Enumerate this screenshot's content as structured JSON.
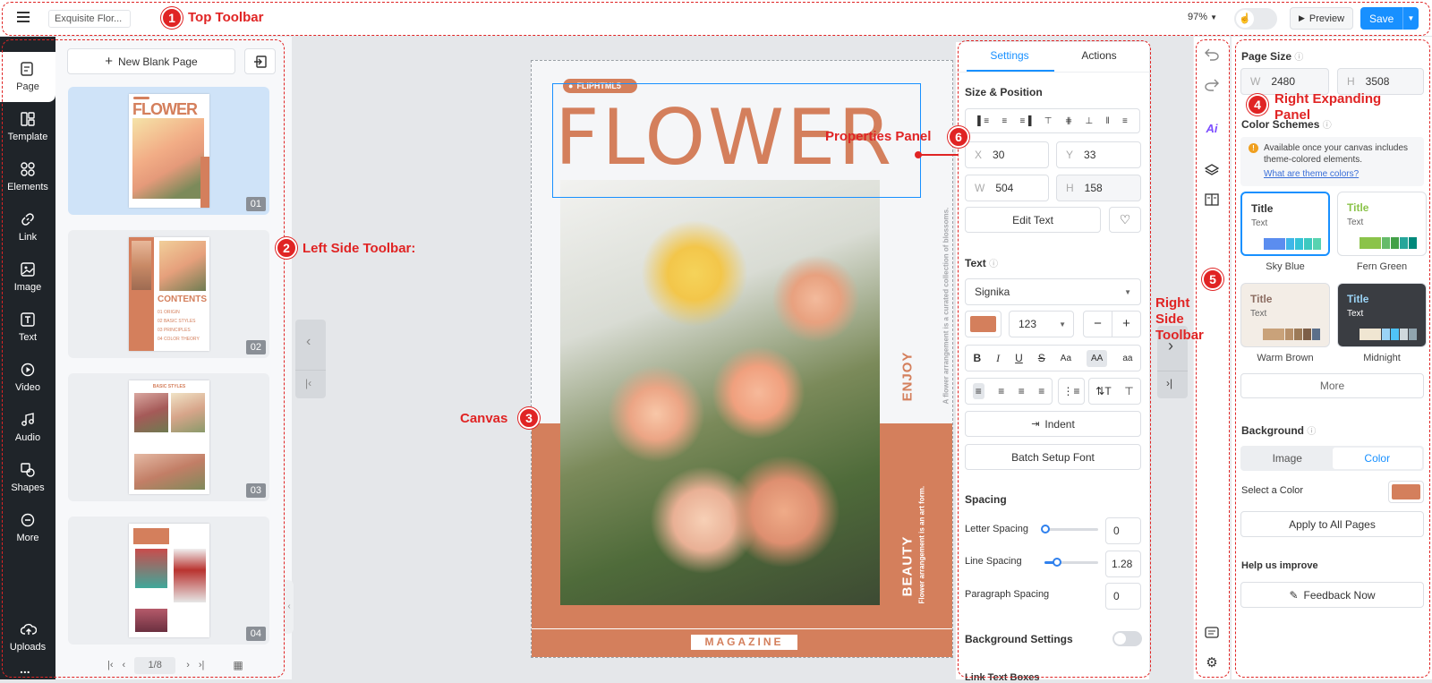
{
  "colors": {
    "accent": "#1890ff",
    "annotation": "#e02424",
    "brand": "#d47f5c",
    "sidebar": "#1f2429"
  },
  "topbar": {
    "menu_icon": "hamburger-icon",
    "doc_title": "Exquisite Flor...",
    "zoom": "97%",
    "preview_label": "Preview",
    "save_label": "Save"
  },
  "annotations": {
    "a1": {
      "num": "1",
      "label": "Top Toolbar"
    },
    "a2": {
      "num": "2",
      "label": "Left Side Toolbar:"
    },
    "a3": {
      "num": "3",
      "label": "Canvas"
    },
    "a4": {
      "num": "4",
      "label": "Right Expanding Panel"
    },
    "a5": {
      "num": "5",
      "label": "Right Side Toolbar"
    },
    "a6": {
      "num": "6",
      "label": "Properties Panel"
    }
  },
  "sidebar": {
    "items": [
      {
        "label": "Page",
        "icon": "page-icon"
      },
      {
        "label": "Template",
        "icon": "template-icon"
      },
      {
        "label": "Elements",
        "icon": "elements-icon"
      },
      {
        "label": "Link",
        "icon": "link-icon"
      },
      {
        "label": "Image",
        "icon": "image-icon"
      },
      {
        "label": "Text",
        "icon": "text-icon"
      },
      {
        "label": "Video",
        "icon": "video-icon"
      },
      {
        "label": "Audio",
        "icon": "audio-icon"
      },
      {
        "label": "Shapes",
        "icon": "shapes-icon"
      },
      {
        "label": "More",
        "icon": "more-icon"
      },
      {
        "label": "Uploads",
        "icon": "uploads-icon"
      }
    ],
    "overflow": "..."
  },
  "pages_panel": {
    "new_page_label": "New Blank Page",
    "thumbs": [
      {
        "num": "01",
        "title": "FLOWER"
      },
      {
        "num": "02",
        "title": "CONTENTS",
        "items": [
          "01  ORIGIN",
          "02  BASIC STYLES",
          "03  PRINCIPLES",
          "04  COLOR THEORY"
        ]
      },
      {
        "num": "03",
        "title": "BASIC STYLES"
      },
      {
        "num": "04"
      }
    ],
    "pager": {
      "current": "1/8"
    }
  },
  "canvas": {
    "logo": "FLIPHTML5",
    "headline": "FLOWER",
    "side_text_1": "A flower arrangement is a curated collection of blossoms.",
    "enjoy": "ENJOY",
    "beauty": "BEAUTY",
    "side_text_2": "Flower arrangement is an art form.",
    "footer": "MAGAZINE"
  },
  "props": {
    "tabs": {
      "settings": "Settings",
      "actions": "Actions"
    },
    "size_position": "Size & Position",
    "x_label": "X",
    "x": "30",
    "y_label": "Y",
    "y": "33",
    "w_label": "W",
    "w": "504",
    "h_label": "H",
    "h": "158",
    "edit_text": "Edit Text",
    "text_section": "Text",
    "font": "Signika",
    "font_size": "123",
    "indent": "Indent",
    "batch_font": "Batch Setup Font",
    "spacing": "Spacing",
    "letter_spacing_label": "Letter Spacing",
    "letter_spacing": "0",
    "line_spacing_label": "Line Spacing",
    "line_spacing": "1.28",
    "paragraph_spacing_label": "Paragraph Spacing",
    "paragraph_spacing": "0",
    "background_settings": "Background Settings",
    "link_text_boxes": "Link Text Boxes",
    "case_buttons": [
      "Aa",
      "AA",
      "aa"
    ]
  },
  "right_panel": {
    "page_size": "Page Size",
    "w_label": "W",
    "w": "2480",
    "h_label": "H",
    "h": "3508",
    "color_schemes": "Color Schemes",
    "notice": "Available once your canvas includes theme-colored elements.",
    "notice_link": "What are theme colors?",
    "schemes": [
      {
        "name": "Sky Blue",
        "title": "Title",
        "text": "Text",
        "title_color": "#333333",
        "bg": "#ffffff",
        "swatches": [
          "#5b8def",
          "#3fb6e8",
          "#35c3d6",
          "#3dc9c0",
          "#58d3b0"
        ]
      },
      {
        "name": "Fern Green",
        "title": "Title",
        "text": "Text",
        "title_color": "#8bc34a",
        "bg": "#ffffff",
        "swatches": [
          "#8bc34a",
          "#66bb6a",
          "#43a047",
          "#26a69a",
          "#00897b"
        ]
      },
      {
        "name": "Warm Brown",
        "title": "Title",
        "text": "Text",
        "title_color": "#8d6e63",
        "bg": "#f3ede6",
        "swatches": [
          "#c9a27a",
          "#b7906a",
          "#9c7a58",
          "#7d5f48",
          "#5b6f8a"
        ]
      },
      {
        "name": "Midnight",
        "title": "Title",
        "text": "Text",
        "title_color": "#9ad3f5",
        "bg": "#3a3d42",
        "swatches": [
          "#f0e6d2",
          "#9ad3f5",
          "#4fc3f7",
          "#cfd8dc",
          "#90a4ae"
        ]
      }
    ],
    "more": "More",
    "background": "Background",
    "image_tab": "Image",
    "color_tab": "Color",
    "select_color": "Select a Color",
    "selected_color": "#d47f5c",
    "apply_all": "Apply to All Pages",
    "help": "Help us improve",
    "feedback": "Feedback Now"
  }
}
